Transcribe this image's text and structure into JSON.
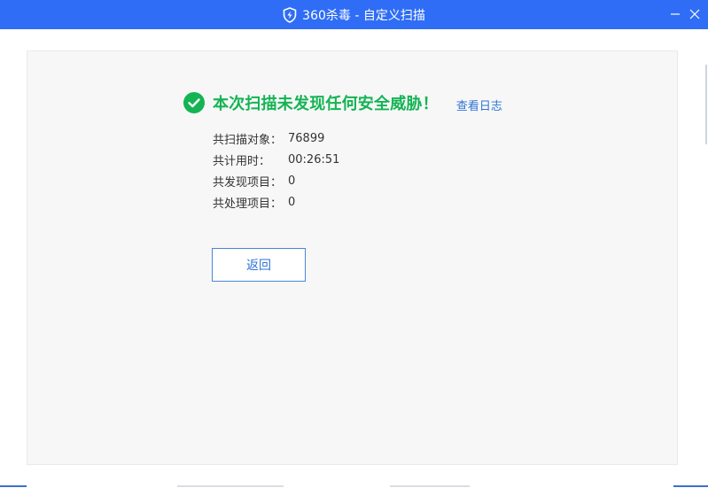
{
  "window": {
    "title": "360杀毒 - 自定义扫描",
    "accent_color": "#2f6df6",
    "icons": [
      "shield-icon",
      "minimize-icon",
      "close-icon"
    ]
  },
  "result": {
    "title": "本次扫描未发现任何安全威胁！",
    "title_color": "#14b453",
    "status_icon": "check-circle-icon",
    "view_log_label": "查看日志"
  },
  "stats": {
    "items": [
      {
        "label": "共扫描对象：",
        "value": "76899"
      },
      {
        "label": "共计用时：",
        "value": "00:26:51"
      },
      {
        "label": "共发现项目：",
        "value": "0"
      },
      {
        "label": "共处理项目：",
        "value": "0"
      }
    ]
  },
  "actions": {
    "back_label": "返回"
  }
}
